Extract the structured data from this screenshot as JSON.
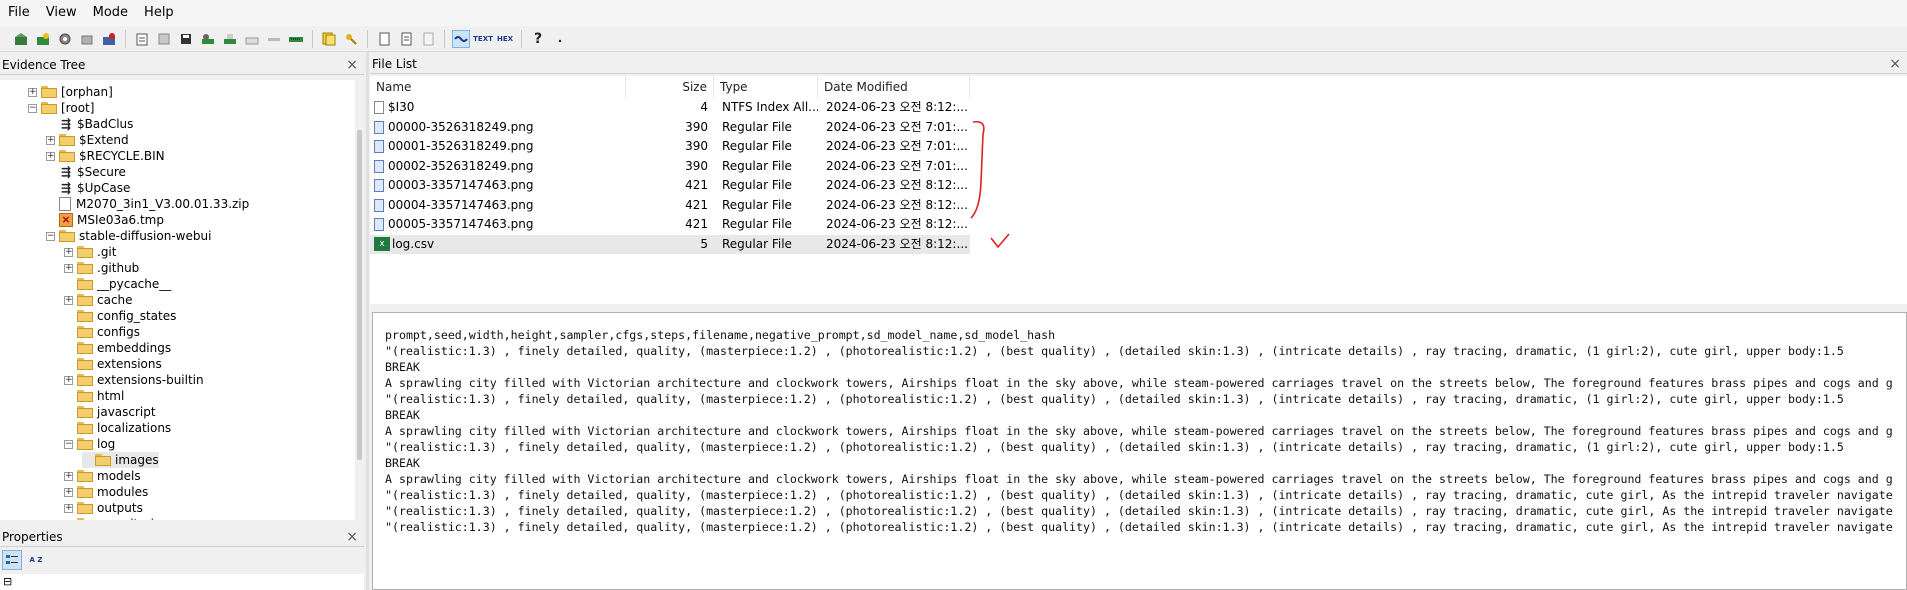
{
  "menu": [
    "File",
    "View",
    "Mode",
    "Help"
  ],
  "toolbar": {
    "icons": [
      "open-case-icon",
      "add-evidence-icon",
      "add-image-icon",
      "remove-evidence-icon",
      "remove-all-icon",
      "export-icon",
      "save-icon",
      "save-as-icon",
      "image-disk-icon",
      "verify-icon",
      "decrypt-icon",
      "acquire-icon",
      "mount-icon",
      "find-icon",
      "hash-icon",
      "new-doc-icon",
      "report-icon",
      "copy-icon",
      "auto-view-icon",
      "text-view-icon",
      "hex-view-icon",
      "help-icon",
      "dropdown-icon"
    ],
    "text_label": "TEXT",
    "hex_label": "HEX",
    "help_glyph": "?"
  },
  "evidence_tree": {
    "title": "Evidence Tree",
    "close": "×",
    "nodes": [
      {
        "label": "[orphan]",
        "type": "folder",
        "expander": "+"
      },
      {
        "label": "[root]",
        "type": "folder",
        "expander": "−"
      },
      {
        "label": "$BadClus",
        "type": "meta"
      },
      {
        "label": "$Extend",
        "type": "folder",
        "expander": "+"
      },
      {
        "label": "$RECYCLE.BIN",
        "type": "folder",
        "expander": "+"
      },
      {
        "label": "$Secure",
        "type": "meta"
      },
      {
        "label": "$UpCase",
        "type": "meta"
      },
      {
        "label": "M2070_3in1_V3.00.01.33.zip",
        "type": "file"
      },
      {
        "label": "MSIe03a6.tmp",
        "type": "deleted"
      },
      {
        "label": "stable-diffusion-webui",
        "type": "folder",
        "expander": "−"
      },
      {
        "label": ".git",
        "type": "folder",
        "expander": "+"
      },
      {
        "label": ".github",
        "type": "folder",
        "expander": "+"
      },
      {
        "label": "__pycache__",
        "type": "folder"
      },
      {
        "label": "cache",
        "type": "folder",
        "expander": "+"
      },
      {
        "label": "config_states",
        "type": "folder"
      },
      {
        "label": "configs",
        "type": "folder"
      },
      {
        "label": "embeddings",
        "type": "folder"
      },
      {
        "label": "extensions",
        "type": "folder"
      },
      {
        "label": "extensions-builtin",
        "type": "folder",
        "expander": "+"
      },
      {
        "label": "html",
        "type": "folder"
      },
      {
        "label": "javascript",
        "type": "folder"
      },
      {
        "label": "localizations",
        "type": "folder"
      },
      {
        "label": "log",
        "type": "folder",
        "expander": "−"
      },
      {
        "label": "images",
        "type": "folder"
      },
      {
        "label": "models",
        "type": "folder",
        "expander": "+"
      },
      {
        "label": "modules",
        "type": "folder",
        "expander": "+"
      },
      {
        "label": "outputs",
        "type": "folder",
        "expander": "+"
      },
      {
        "label": "repositories",
        "type": "folder",
        "expander": "+"
      }
    ]
  },
  "properties": {
    "title": "Properties",
    "close": "×",
    "sort_label": "A Z",
    "expander": "⊟"
  },
  "file_list": {
    "title": "File List",
    "close": "×",
    "columns": [
      "Name",
      "Size",
      "Type",
      "Date Modified"
    ],
    "rows": [
      {
        "name": "$I30",
        "size": "4",
        "type": "NTFS Index All...",
        "date": "2024-06-23 오전 8:12:...",
        "icon": "plain"
      },
      {
        "name": "00000-3526318249.png",
        "size": "390",
        "type": "Regular File",
        "date": "2024-06-23 오전 7:01:...",
        "icon": "png"
      },
      {
        "name": "00001-3526318249.png",
        "size": "390",
        "type": "Regular File",
        "date": "2024-06-23 오전 7:01:...",
        "icon": "png"
      },
      {
        "name": "00002-3526318249.png",
        "size": "390",
        "type": "Regular File",
        "date": "2024-06-23 오전 7:01:...",
        "icon": "png"
      },
      {
        "name": "00003-3357147463.png",
        "size": "421",
        "type": "Regular File",
        "date": "2024-06-23 오전 8:12:...",
        "icon": "png"
      },
      {
        "name": "00004-3357147463.png",
        "size": "421",
        "type": "Regular File",
        "date": "2024-06-23 오전 8:12:...",
        "icon": "png"
      },
      {
        "name": "00005-3357147463.png",
        "size": "421",
        "type": "Regular File",
        "date": "2024-06-23 오전 8:12:...",
        "icon": "png"
      },
      {
        "name": "log.csv",
        "size": "5",
        "type": "Regular File",
        "date": "2024-06-23 오전 8:12:...",
        "icon": "csv"
      }
    ]
  },
  "annotation_color": "#e02020",
  "preview_lines": [
    "prompt,seed,width,height,sampler,cfgs,steps,filename,negative_prompt,sd_model_name,sd_model_hash",
    "\"(realistic:1.3) , finely detailed, quality, (masterpiece:1.2) , (photorealistic:1.2) , (best quality) , (detailed skin:1.3) , (intricate details) , ray tracing, dramatic, (1 girl:2), cute girl, upper body:1.5",
    "BREAK",
    "A sprawling city filled with Victorian architecture and clockwork towers, Airships float in the sky above, while steam-powered carriages travel on the streets below, The foreground features brass pipes and cogs and g",
    "\"(realistic:1.3) , finely detailed, quality, (masterpiece:1.2) , (photorealistic:1.2) , (best quality) , (detailed skin:1.3) , (intricate details) , ray tracing, dramatic, (1 girl:2), cute girl, upper body:1.5",
    "BREAK",
    "A sprawling city filled with Victorian architecture and clockwork towers, Airships float in the sky above, while steam-powered carriages travel on the streets below, The foreground features brass pipes and cogs and g",
    "\"(realistic:1.3) , finely detailed, quality, (masterpiece:1.2) , (photorealistic:1.2) , (best quality) , (detailed skin:1.3) , (intricate details) , ray tracing, dramatic, (1 girl:2), cute girl, upper body:1.5",
    "BREAK",
    "A sprawling city filled with Victorian architecture and clockwork towers, Airships float in the sky above, while steam-powered carriages travel on the streets below, The foreground features brass pipes and cogs and g",
    "\"(realistic:1.3) , finely detailed, quality, (masterpiece:1.2) , (photorealistic:1.2) , (best quality) , (detailed skin:1.3) , (intricate details) , ray tracing, dramatic, cute girl, As the intrepid traveler navigate",
    "\"(realistic:1.3) , finely detailed, quality, (masterpiece:1.2) , (photorealistic:1.2) , (best quality) , (detailed skin:1.3) , (intricate details) , ray tracing, dramatic, cute girl, As the intrepid traveler navigate",
    "\"(realistic:1.3) , finely detailed, quality, (masterpiece:1.2) , (photorealistic:1.2) , (best quality) , (detailed skin:1.3) , (intricate details) , ray tracing, dramatic, cute girl, As the intrepid traveler navigate"
  ]
}
